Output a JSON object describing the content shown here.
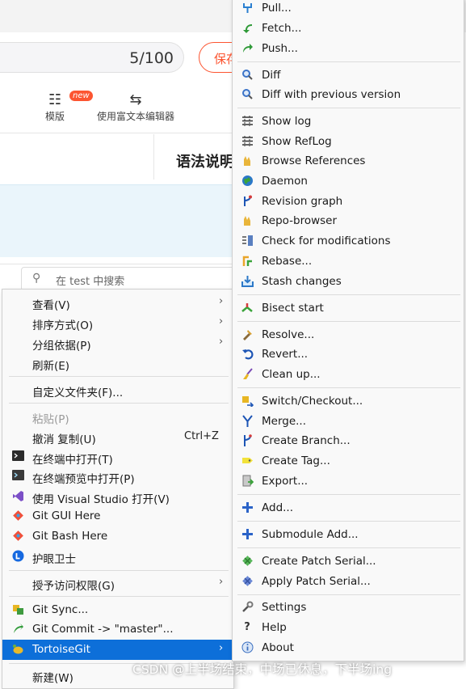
{
  "editor": {
    "word_count": "5/100",
    "save_label": "保存",
    "tools": [
      {
        "label": "模版",
        "badge": "new",
        "icon": "template-icon"
      },
      {
        "label": "使用富文本编辑器",
        "icon": "swap-icon"
      }
    ],
    "grammar_title": "语法说明",
    "search_placeholder": "在 test 中搜索"
  },
  "context_menu": {
    "items": [
      {
        "label": "查看(V)",
        "arrow": "›"
      },
      {
        "label": "排序方式(O)",
        "arrow": "›"
      },
      {
        "label": "分组依据(P)",
        "arrow": "›"
      },
      {
        "label": "刷新(E)"
      },
      {
        "label": "自定义文件夹(F)..."
      },
      {
        "label": "粘贴(P)",
        "disabled": true
      },
      {
        "label": "撤消 复制(U)",
        "shortcut": "Ctrl+Z"
      },
      {
        "label": "在终端中打开(T)",
        "icon": "terminal-icon"
      },
      {
        "label": "在终端预览中打开(P)",
        "icon": "terminal-preview-icon"
      },
      {
        "label": "使用 Visual Studio 打开(V)",
        "icon": "visual-studio-icon"
      },
      {
        "label": "Git GUI Here",
        "icon": "git-gui-icon"
      },
      {
        "label": "Git Bash Here",
        "icon": "git-bash-icon"
      },
      {
        "label": "护眼卫士",
        "icon": "eye-guard-icon"
      },
      {
        "label": "授予访问权限(G)",
        "arrow": "›"
      },
      {
        "label": "Git Sync...",
        "icon": "git-sync-icon"
      },
      {
        "label": "Git Commit -> \"master\"...",
        "icon": "git-commit-icon"
      },
      {
        "label": "TortoiseGit",
        "icon": "tortoisegit-icon",
        "arrow": "›",
        "highlighted": true
      },
      {
        "label": "新建(W)"
      }
    ]
  },
  "tortoise_menu": {
    "items": [
      {
        "label": "Pull...",
        "icon": "pull-icon"
      },
      {
        "label": "Fetch...",
        "icon": "fetch-icon"
      },
      {
        "label": "Push...",
        "icon": "push-icon"
      },
      {
        "label": "Diff",
        "icon": "diff-icon"
      },
      {
        "label": "Diff with previous version",
        "icon": "diff-previous-icon"
      },
      {
        "label": "Show log",
        "icon": "show-log-icon"
      },
      {
        "label": "Show RefLog",
        "icon": "reflog-icon"
      },
      {
        "label": "Browse References",
        "icon": "browse-references-icon"
      },
      {
        "label": "Daemon",
        "icon": "daemon-icon"
      },
      {
        "label": "Revision graph",
        "icon": "revision-graph-icon"
      },
      {
        "label": "Repo-browser",
        "icon": "repo-browser-icon"
      },
      {
        "label": "Check for modifications",
        "icon": "check-modifications-icon"
      },
      {
        "label": "Rebase...",
        "icon": "rebase-icon"
      },
      {
        "label": "Stash changes",
        "icon": "stash-icon"
      },
      {
        "label": "Bisect start",
        "icon": "bisect-icon"
      },
      {
        "label": "Resolve...",
        "icon": "resolve-icon"
      },
      {
        "label": "Revert...",
        "icon": "revert-icon"
      },
      {
        "label": "Clean up...",
        "icon": "cleanup-icon"
      },
      {
        "label": "Switch/Checkout...",
        "icon": "switch-checkout-icon"
      },
      {
        "label": "Merge...",
        "icon": "merge-icon"
      },
      {
        "label": "Create Branch...",
        "icon": "create-branch-icon"
      },
      {
        "label": "Create Tag...",
        "icon": "create-tag-icon"
      },
      {
        "label": "Export...",
        "icon": "export-icon"
      },
      {
        "label": "Add...",
        "icon": "add-icon"
      },
      {
        "label": "Submodule Add...",
        "icon": "submodule-add-icon"
      },
      {
        "label": "Create Patch Serial...",
        "icon": "create-patch-icon"
      },
      {
        "label": "Apply Patch Serial...",
        "icon": "apply-patch-icon"
      },
      {
        "label": "Settings",
        "icon": "settings-icon"
      },
      {
        "label": "Help",
        "icon": "help-icon"
      },
      {
        "label": "About",
        "icon": "about-icon"
      }
    ]
  },
  "watermark": "CSDN @上半场结束，中场已休息，下半场ing",
  "colors": {
    "accent": "#fc5531",
    "highlight": "#0d6fd9"
  }
}
